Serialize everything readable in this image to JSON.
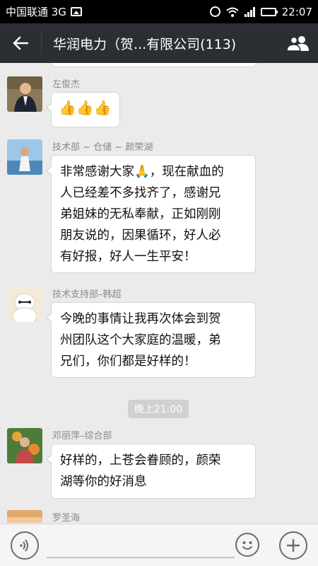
{
  "status_bar": {
    "carrier": "中国联通 3G",
    "time": "22:07"
  },
  "title_bar": {
    "title": "华润电力（贺...有限公司(113)"
  },
  "messages": [
    {
      "sender": "左俊杰",
      "text": "👍👍👍"
    },
    {
      "sender": "技术部 ~ 仓储 ~ 颜荣湖",
      "lines": [
        "非常感谢大家🙏，现在献血的",
        "人已经差不多找齐了，感谢兄",
        "弟姐妹的无私奉献，正如刚刚",
        "朋友说的，因果循环，好人必",
        "有好报，好人一生平安！"
      ]
    },
    {
      "sender": "技术支持部–韩超",
      "lines": [
        "今晚的事情让我再次体会到贺",
        "州团队这个大家庭的温暖，弟",
        "兄们，你们都是好样的！"
      ]
    },
    {
      "sender": "邓丽萍–综合部",
      "lines": [
        "好样的，上苍会眷顾的，颜荣",
        "湖等你的好消息"
      ]
    },
    {
      "sender": "罗圣海"
    }
  ],
  "time_separator": "晚上21:00",
  "input": {
    "value": ""
  }
}
